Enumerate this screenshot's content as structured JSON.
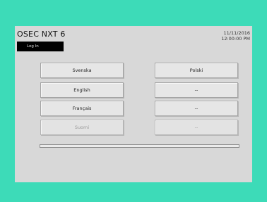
{
  "app": {
    "title": "OSEC NXT 6",
    "login_label": "Log In",
    "date": "11/11/2016",
    "time": "12:00:00 PM"
  },
  "languages": {
    "svenska": "Svenska",
    "polski": "Polski",
    "english": "English",
    "slot_2": "--",
    "francais": "Français",
    "slot_3": "--",
    "suomi": "Suomi",
    "slot_4": "--"
  },
  "progress": {
    "fraction": 0.0
  }
}
